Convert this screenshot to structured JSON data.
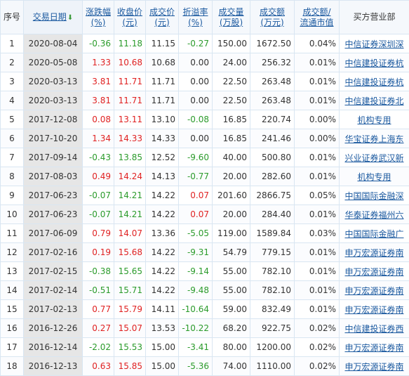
{
  "headers": {
    "index": "序号",
    "date": "交易日期",
    "change_pct": [
      "涨跌幅",
      "(%)"
    ],
    "close": [
      "收盘价",
      "(元)"
    ],
    "deal_price": [
      "成交价",
      "(元)"
    ],
    "premium_rate": [
      "折溢率",
      "(%)"
    ],
    "volume": [
      "成交量",
      "(万股)"
    ],
    "amount": [
      "成交额",
      "(万元)"
    ],
    "ratio": [
      "成交额/",
      "流通市值"
    ],
    "buyer": "买方营业部"
  },
  "colors": {
    "up": "#e02222",
    "down": "#2b9b2b",
    "link": "#1c5aa0"
  },
  "sort_icon": "arrow-down-icon",
  "rows": [
    {
      "idx": "1",
      "date": "2020-08-04",
      "chg": "-0.36",
      "close": "11.18",
      "price": "11.15",
      "prem": "-0.27",
      "vol": "150.00",
      "amt": "1672.50",
      "ratio": "0.04%",
      "buyer": "中信证券深圳深",
      "dir": "down",
      "pdir": "down"
    },
    {
      "idx": "2",
      "date": "2020-05-08",
      "chg": "1.33",
      "close": "10.68",
      "price": "10.68",
      "prem": "0.00",
      "vol": "24.00",
      "amt": "256.32",
      "ratio": "0.01%",
      "buyer": "中信建投证券杭",
      "dir": "up",
      "pdir": "flat"
    },
    {
      "idx": "3",
      "date": "2020-03-13",
      "chg": "3.81",
      "close": "11.71",
      "price": "11.71",
      "prem": "0.00",
      "vol": "22.50",
      "amt": "263.48",
      "ratio": "0.01%",
      "buyer": "中信建投证券杭",
      "dir": "up",
      "pdir": "flat"
    },
    {
      "idx": "4",
      "date": "2020-03-13",
      "chg": "3.81",
      "close": "11.71",
      "price": "11.71",
      "prem": "0.00",
      "vol": "22.50",
      "amt": "263.48",
      "ratio": "0.01%",
      "buyer": "中信建投证券北",
      "dir": "up",
      "pdir": "flat"
    },
    {
      "idx": "5",
      "date": "2017-12-08",
      "chg": "0.08",
      "close": "13.11",
      "price": "13.10",
      "prem": "-0.08",
      "vol": "16.85",
      "amt": "220.74",
      "ratio": "0.00%",
      "buyer": "机构专用",
      "dir": "up",
      "pdir": "down"
    },
    {
      "idx": "6",
      "date": "2017-10-20",
      "chg": "1.34",
      "close": "14.33",
      "price": "14.33",
      "prem": "0.00",
      "vol": "16.85",
      "amt": "241.46",
      "ratio": "0.00%",
      "buyer": "华宝证券上海东",
      "dir": "up",
      "pdir": "flat"
    },
    {
      "idx": "7",
      "date": "2017-09-14",
      "chg": "-0.43",
      "close": "13.85",
      "price": "12.52",
      "prem": "-9.60",
      "vol": "40.00",
      "amt": "500.80",
      "ratio": "0.01%",
      "buyer": "兴业证券武汉新",
      "dir": "down",
      "pdir": "down"
    },
    {
      "idx": "8",
      "date": "2017-08-03",
      "chg": "0.49",
      "close": "14.24",
      "price": "14.13",
      "prem": "-0.77",
      "vol": "20.00",
      "amt": "282.60",
      "ratio": "0.01%",
      "buyer": "机构专用",
      "dir": "up",
      "pdir": "down"
    },
    {
      "idx": "9",
      "date": "2017-06-23",
      "chg": "-0.07",
      "close": "14.21",
      "price": "14.22",
      "prem": "0.07",
      "vol": "201.60",
      "amt": "2866.75",
      "ratio": "0.05%",
      "buyer": "中国国际金融深",
      "dir": "down",
      "pdir": "up"
    },
    {
      "idx": "10",
      "date": "2017-06-23",
      "chg": "-0.07",
      "close": "14.21",
      "price": "14.22",
      "prem": "0.07",
      "vol": "20.00",
      "amt": "284.40",
      "ratio": "0.01%",
      "buyer": "华泰证券福州六",
      "dir": "down",
      "pdir": "up"
    },
    {
      "idx": "11",
      "date": "2017-06-09",
      "chg": "0.79",
      "close": "14.07",
      "price": "13.36",
      "prem": "-5.05",
      "vol": "119.00",
      "amt": "1589.84",
      "ratio": "0.03%",
      "buyer": "中国国际金融广",
      "dir": "up",
      "pdir": "down"
    },
    {
      "idx": "12",
      "date": "2017-02-16",
      "chg": "0.19",
      "close": "15.68",
      "price": "14.22",
      "prem": "-9.31",
      "vol": "54.79",
      "amt": "779.15",
      "ratio": "0.01%",
      "buyer": "申万宏源证券南",
      "dir": "up",
      "pdir": "down"
    },
    {
      "idx": "13",
      "date": "2017-02-15",
      "chg": "-0.38",
      "close": "15.65",
      "price": "14.22",
      "prem": "-9.14",
      "vol": "55.00",
      "amt": "782.10",
      "ratio": "0.01%",
      "buyer": "申万宏源证券南",
      "dir": "down",
      "pdir": "down"
    },
    {
      "idx": "14",
      "date": "2017-02-14",
      "chg": "-0.51",
      "close": "15.71",
      "price": "14.22",
      "prem": "-9.48",
      "vol": "55.00",
      "amt": "782.10",
      "ratio": "0.01%",
      "buyer": "申万宏源证券南",
      "dir": "down",
      "pdir": "down"
    },
    {
      "idx": "15",
      "date": "2017-02-13",
      "chg": "0.77",
      "close": "15.79",
      "price": "14.11",
      "prem": "-10.64",
      "vol": "59.00",
      "amt": "832.49",
      "ratio": "0.01%",
      "buyer": "申万宏源证券南",
      "dir": "up",
      "pdir": "down"
    },
    {
      "idx": "16",
      "date": "2016-12-26",
      "chg": "0.27",
      "close": "15.07",
      "price": "13.53",
      "prem": "-10.22",
      "vol": "68.20",
      "amt": "922.75",
      "ratio": "0.02%",
      "buyer": "中信建投证券西",
      "dir": "up",
      "pdir": "down"
    },
    {
      "idx": "17",
      "date": "2016-12-14",
      "chg": "-2.02",
      "close": "15.53",
      "price": "15.00",
      "prem": "-3.41",
      "vol": "80.00",
      "amt": "1200.00",
      "ratio": "0.02%",
      "buyer": "申万宏源证券南",
      "dir": "down",
      "pdir": "down"
    },
    {
      "idx": "18",
      "date": "2016-12-13",
      "chg": "0.63",
      "close": "15.85",
      "price": "15.00",
      "prem": "-5.36",
      "vol": "74.00",
      "amt": "1110.00",
      "ratio": "0.02%",
      "buyer": "申万宏源证券南",
      "dir": "up",
      "pdir": "down"
    }
  ]
}
